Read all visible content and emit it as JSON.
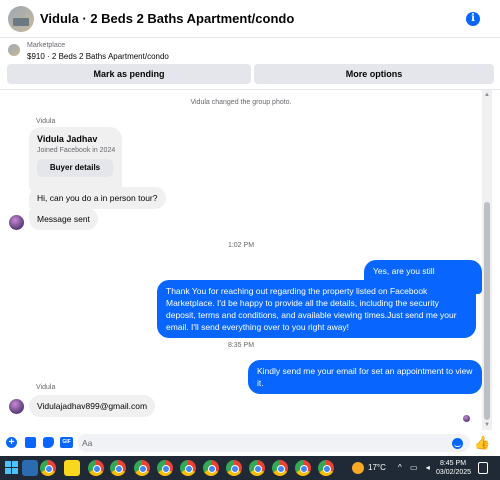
{
  "header": {
    "title": "Vidula · 2 Beds 2 Baths Apartment/condo"
  },
  "marketplace": {
    "label": "Marketplace",
    "listing": "$910 · 2 Beds 2 Baths Apartment/condo",
    "btn_pending": "Mark as pending",
    "btn_more": "More options"
  },
  "messages": {
    "system_note": "Vidula changed the group photo.",
    "sender_name_1": "Vidula",
    "profile_card": {
      "name": "Vidula Jadhav",
      "joined": "Joined Facebook in 2024",
      "button": "Buyer details"
    },
    "in_1": "Hi, can you do a in person tour?",
    "in_2": "Message sent",
    "time_1": "1:02 PM",
    "out_1": "Yes, are you still interested?",
    "out_2": "Thank You for reaching out regarding the property listed on Facebook Marketplace. I'd be happy to provide all the details, including the security deposit, terms and conditions, and available viewing times.Just send me your email. I'll send everything over to you right away!",
    "time_2": "8:35 PM",
    "out_3": "Kindly send me your email for set an appointment to view it.",
    "sender_name_2": "Vidula",
    "in_3": "Vidulajadhav899@gmail.com"
  },
  "composer": {
    "placeholder": "Aa"
  },
  "taskbar": {
    "temperature": "17°C",
    "time": "8:45 PM",
    "date": "03/02/2025"
  },
  "colors": {
    "accent": "#0866ff",
    "bubble_in": "#f0f0f0",
    "taskbar": "#1f2a36"
  }
}
